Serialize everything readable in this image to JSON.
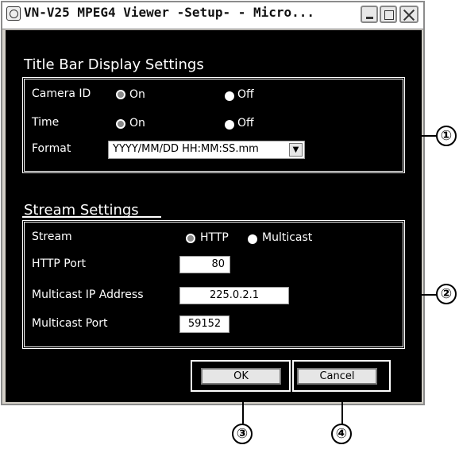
{
  "window": {
    "title": "VN-V25 MPEG4 Viewer -Setup- - Micro..."
  },
  "title_bar_section": {
    "heading": "Title Bar Display Settings",
    "camera_id_label": "Camera ID",
    "time_label": "Time",
    "format_label": "Format",
    "on_label": "On",
    "off_label": "Off",
    "format_value": "YYYY/MM/DD HH:MM:SS.mm",
    "camera_id_selected": "On",
    "time_selected": "On"
  },
  "stream_section": {
    "heading": "Stream Settings",
    "stream_label": "Stream",
    "http_label": "HTTP",
    "multicast_label": "Multicast",
    "stream_selected": "HTTP",
    "http_port_label": "HTTP Port",
    "http_port_value": "80",
    "multicast_ip_label": "Multicast IP Address",
    "multicast_ip_value": "225.0.2.1",
    "multicast_port_label": "Multicast Port",
    "multicast_port_value": "59152"
  },
  "buttons": {
    "ok": "OK",
    "cancel": "Cancel"
  },
  "callouts": [
    "①",
    "②",
    "③",
    "④"
  ]
}
